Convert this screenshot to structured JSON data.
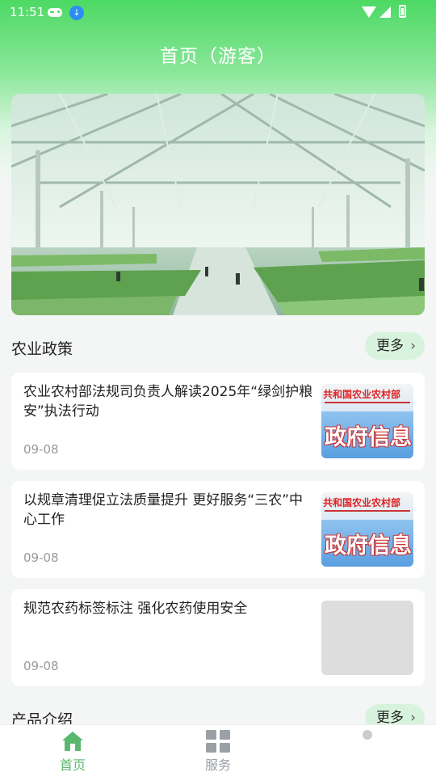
{
  "status_bar": {
    "time": "11:51"
  },
  "header": {
    "title": "首页（游客）"
  },
  "policy_section": {
    "title": "农业政策",
    "more_label": "更多",
    "items": [
      {
        "title": "农业农村部法规司负责人解读2025年“绿剑护粮安”执法行动",
        "date": "09-08",
        "thumb_top": "共和国农业农村部",
        "thumb_bottom": "政府信息"
      },
      {
        "title": "以规章清理促立法质量提升 更好服务“三农”中心工作",
        "date": "09-08",
        "thumb_top": "共和国农业农村部",
        "thumb_bottom": "政府信息"
      },
      {
        "title": "规范农药标签标注 强化农药使用安全",
        "date": "09-08"
      }
    ]
  },
  "product_section": {
    "title": "产品介绍",
    "more_label": "更多"
  },
  "tabs": [
    {
      "label": "首页",
      "icon": "home-icon"
    },
    {
      "label": "服务",
      "icon": "grid-icon"
    }
  ],
  "colors": {
    "primary": "#4cd964",
    "active_tab": "#5ab86e",
    "inactive_tab": "#9aa0a6"
  }
}
